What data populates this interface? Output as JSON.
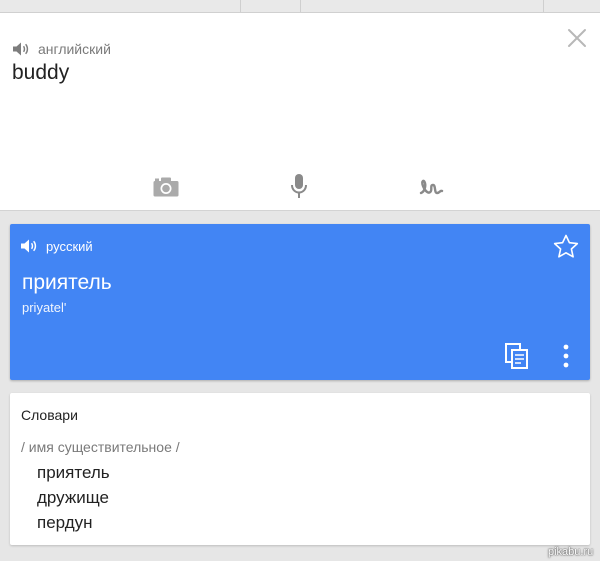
{
  "source": {
    "language_label": "английский",
    "input_text": "buddy",
    "icons": [
      "speaker-icon",
      "close-icon",
      "camera-icon",
      "microphone-icon",
      "handwriting-icon"
    ]
  },
  "translation": {
    "language_label": "русский",
    "text": "приятель",
    "transliteration": "priyatel'",
    "background_color": "#4285f4",
    "icons": [
      "speaker-icon",
      "star-icon",
      "copy-icon",
      "more-vert-icon"
    ]
  },
  "dictionary": {
    "title": "Словари",
    "part_of_speech": "/ имя существительное /",
    "entries": [
      "приятель",
      "дружище",
      "пердун"
    ]
  },
  "watermark": "pikabu.ru"
}
